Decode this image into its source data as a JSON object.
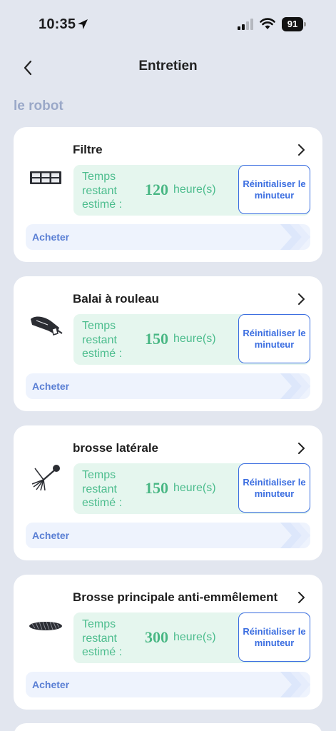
{
  "status": {
    "time": "10:35",
    "battery": "91"
  },
  "nav": {
    "title": "Entretien"
  },
  "section": {
    "title": "le robot"
  },
  "cards": [
    {
      "name": "Filtre",
      "icon": "filter-icon",
      "remaining_label": "Temps restant estimé :",
      "hours": "120",
      "unit": "heure(s)",
      "reset_label": "Réinitialiser le minuteur",
      "buy_label": "Acheter"
    },
    {
      "name": "Balai à rouleau",
      "icon": "roller-brush-icon",
      "remaining_label": "Temps restant estimé :",
      "hours": "150",
      "unit": "heure(s)",
      "reset_label": "Réinitialiser le minuteur",
      "buy_label": "Acheter"
    },
    {
      "name": "brosse latérale",
      "icon": "side-brush-icon",
      "remaining_label": "Temps restant estimé :",
      "hours": "150",
      "unit": "heure(s)",
      "reset_label": "Réinitialiser le minuteur",
      "buy_label": "Acheter"
    },
    {
      "name": "Brosse principale anti-emmêlement",
      "icon": "main-brush-icon",
      "remaining_label": "Temps restant estimé :",
      "hours": "300",
      "unit": "heure(s)",
      "reset_label": "Réinitialiser le minuteur",
      "buy_label": "Acheter"
    }
  ],
  "colors": {
    "background": "#e2e6ef",
    "section_title": "#9aa8c8",
    "info_bg": "#e5f6ee",
    "info_text": "#4dbd8e",
    "accent_blue": "#3a6de0",
    "buy_bg": "#eef3fd"
  }
}
